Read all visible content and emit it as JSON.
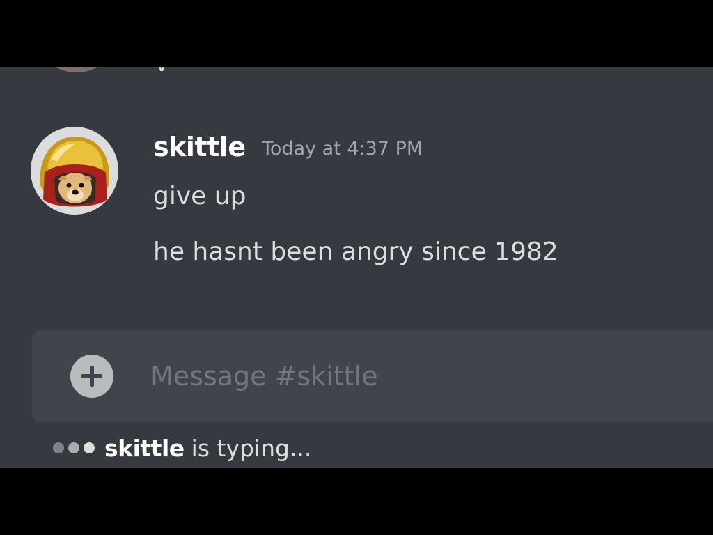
{
  "previous_message": {
    "text_fragment": "y"
  },
  "message": {
    "username": "skittle",
    "timestamp": "Today at 4:37 PM",
    "lines": [
      "give up",
      "he hasnt been angry since 1982"
    ],
    "avatar_icon": "dog-in-helmet-avatar"
  },
  "composer": {
    "placeholder": "Message #skittle",
    "attach_icon": "plus-circle-icon"
  },
  "typing_indicator": {
    "user": "skittle",
    "text": "is typing..."
  },
  "colors": {
    "background": "#36393f",
    "composer_bg": "#40444b",
    "username": "#ffffff",
    "timestamp": "#a3a6aa",
    "message_text": "#dcddde",
    "placeholder": "#72767d"
  }
}
